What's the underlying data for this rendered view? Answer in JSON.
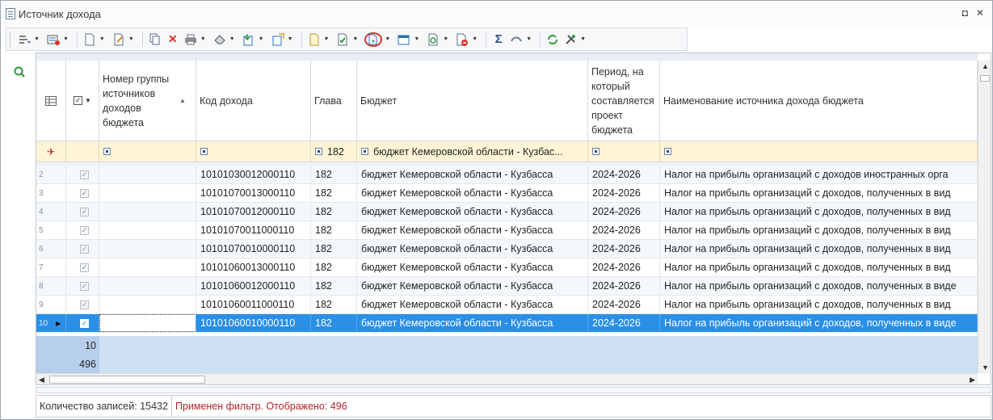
{
  "window": {
    "title": "Источник дохода",
    "restore_label": "◘",
    "close_label": "✕"
  },
  "toolbar": {
    "items": [
      {
        "icon": "sort-icon"
      },
      {
        "icon": "filter-icon"
      },
      {
        "icon": "new-document-icon"
      },
      {
        "icon": "edit-document-icon"
      },
      {
        "icon": "copy-icon"
      },
      {
        "icon": "delete-icon"
      },
      {
        "icon": "print-icon"
      },
      {
        "icon": "clear-icon"
      },
      {
        "icon": "import-icon"
      },
      {
        "icon": "export-icon"
      },
      {
        "icon": "document-settings-icon"
      },
      {
        "icon": "check-icon"
      },
      {
        "icon": "highlighted-document-icon"
      },
      {
        "icon": "calendar-icon"
      },
      {
        "icon": "refresh-document-icon"
      },
      {
        "icon": "cancel-document-icon"
      },
      {
        "icon": "sum-icon"
      },
      {
        "icon": "link-icon"
      },
      {
        "icon": "reload-icon"
      },
      {
        "icon": "tools-icon"
      }
    ]
  },
  "grid": {
    "columns": {
      "group": "Номер группы источников доходов бюджета",
      "code": "Код дохода",
      "chapter": "Глава",
      "budget": "Бюджет",
      "period": "Период, на который составляется проект бюджета",
      "name": "Наименование источника дохода бюджета"
    },
    "filter": {
      "chapter": "182",
      "budget": "бюджет Кемеровской области - Кузбас..."
    },
    "rows": [
      {
        "n": "2",
        "code": "10101030012000110",
        "chapter": "182",
        "budget": "бюджет Кемеровской области - Кузбасса",
        "period": "2024-2026",
        "name": "Налог на прибыль организаций с доходов иностранных орга"
      },
      {
        "n": "3",
        "code": "10101070013000110",
        "chapter": "182",
        "budget": "бюджет Кемеровской области - Кузбасса",
        "period": "2024-2026",
        "name": "Налог на прибыль организаций с доходов, полученных в вид"
      },
      {
        "n": "4",
        "code": "10101070012000110",
        "chapter": "182",
        "budget": "бюджет Кемеровской области - Кузбасса",
        "period": "2024-2026",
        "name": "Налог на прибыль организаций с доходов, полученных в вид"
      },
      {
        "n": "5",
        "code": "10101070011000110",
        "chapter": "182",
        "budget": "бюджет Кемеровской области - Кузбасса",
        "period": "2024-2026",
        "name": "Налог на прибыль организаций с доходов, полученных в вид"
      },
      {
        "n": "6",
        "code": "10101070010000110",
        "chapter": "182",
        "budget": "бюджет Кемеровской области - Кузбасса",
        "period": "2024-2026",
        "name": "Налог на прибыль организаций с доходов, полученных в вид"
      },
      {
        "n": "7",
        "code": "10101060013000110",
        "chapter": "182",
        "budget": "бюджет Кемеровской области - Кузбасса",
        "period": "2024-2026",
        "name": "Налог на прибыль организаций с доходов, полученных в вид"
      },
      {
        "n": "8",
        "code": "10101060012000110",
        "chapter": "182",
        "budget": "бюджет Кемеровской области - Кузбасса",
        "period": "2024-2026",
        "name": "Налог на прибыль организаций с доходов, полученных в виде"
      },
      {
        "n": "9",
        "code": "10101060011000110",
        "chapter": "182",
        "budget": "бюджет Кемеровской области - Кузбасса",
        "period": "2024-2026",
        "name": "Налог на прибыль организаций с доходов, полученных в вид"
      },
      {
        "n": "10",
        "code": "10101060010000110",
        "chapter": "182",
        "budget": "бюджет Кемеровской области - Кузбасса",
        "period": "2024-2026",
        "name": "Налог на прибыль организаций с доходов, полученных в виде"
      }
    ],
    "footer": {
      "selected_count": "10",
      "total_count": "496"
    }
  },
  "status": {
    "records": "Количество записей: 15432",
    "filter": "Применен фильтр. Отображено: 496"
  },
  "colors": {
    "selected": "#2a8fe6",
    "filter_bg": "#fff4d6",
    "status_red": "#b0262a"
  }
}
